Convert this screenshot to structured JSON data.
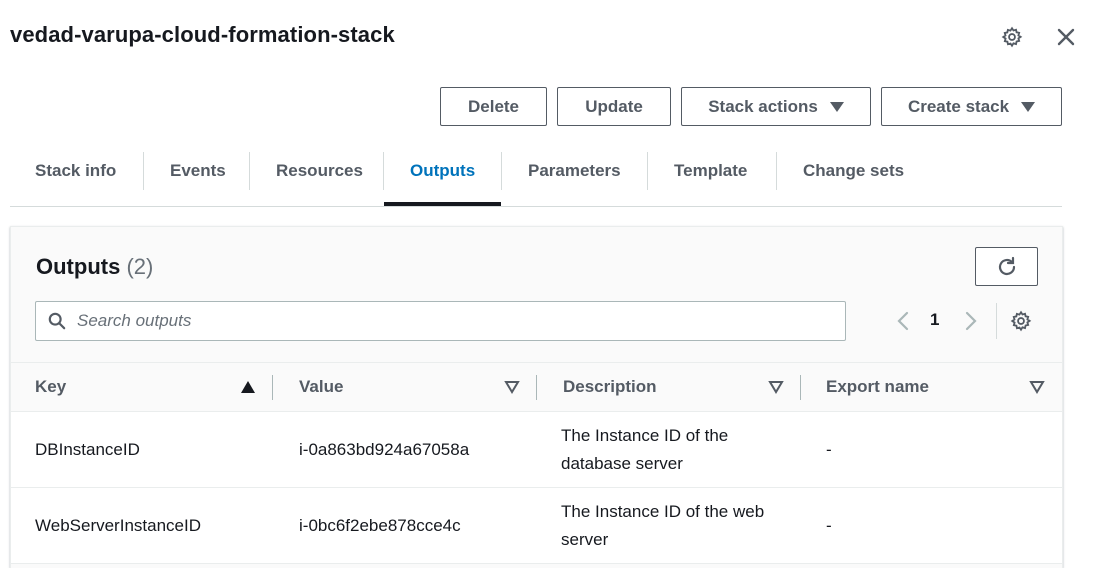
{
  "header": {
    "title": "vedad-varupa-cloud-formation-stack",
    "settings_icon": "gear-icon",
    "close_icon": "close-icon"
  },
  "actions": {
    "delete_label": "Delete",
    "update_label": "Update",
    "stack_actions_label": "Stack actions",
    "create_stack_label": "Create stack"
  },
  "tabs": [
    {
      "label": "Stack info"
    },
    {
      "label": "Events"
    },
    {
      "label": "Resources"
    },
    {
      "label": "Outputs",
      "active": true
    },
    {
      "label": "Parameters"
    },
    {
      "label": "Template"
    },
    {
      "label": "Change sets"
    }
  ],
  "outputs": {
    "title": "Outputs",
    "count": "(2)",
    "search_placeholder": "Search outputs",
    "page": "1",
    "columns": [
      "Key",
      "Value",
      "Description",
      "Export name"
    ],
    "sorted_column": "Key",
    "sort_direction": "ascending",
    "rows": [
      {
        "key": "DBInstanceID",
        "value": "i-0a863bd924a67058a",
        "description": "The Instance ID of the database server",
        "export_name": "-"
      },
      {
        "key": "WebServerInstanceID",
        "value": "i-0bc6f2ebe878cce4c",
        "description": "The Instance ID of the web server",
        "export_name": "-"
      }
    ]
  },
  "colors": {
    "active_tab": "#0073bb",
    "text": "#16191f",
    "muted": "#545b64",
    "border": "#eaeded"
  }
}
